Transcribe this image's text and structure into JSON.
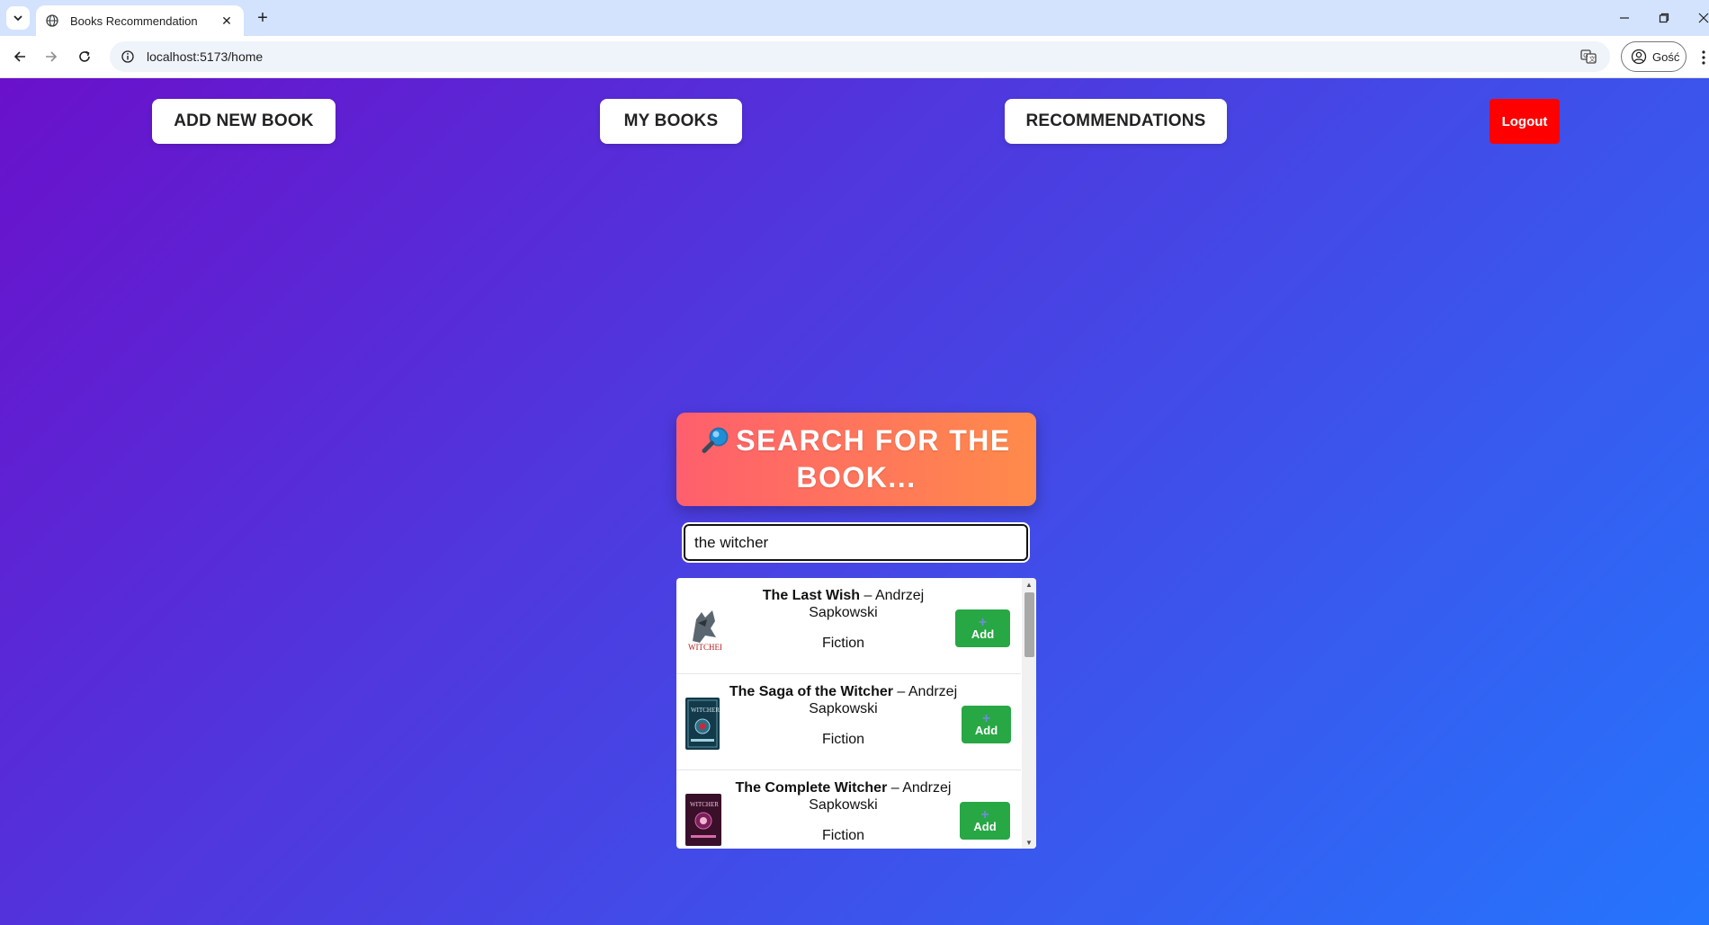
{
  "browser": {
    "tab_title": "Books Recommendation",
    "url": "localhost:5173/home",
    "profile_label": "Gość"
  },
  "nav": {
    "add_new_book": "ADD NEW BOOK",
    "my_books": "MY BOOKS",
    "recommendations": "RECOMMENDATIONS",
    "logout": "Logout"
  },
  "search": {
    "title": "SEARCH FOR THE BOOK...",
    "query": "the witcher"
  },
  "results": [
    {
      "title": "The Last Wish",
      "separator": " – ",
      "author": "Andrzej Sapkowski",
      "genre": "Fiction",
      "add_label": "Add",
      "add_icon": "+"
    },
    {
      "title": "The Saga of the Witcher",
      "separator": " – ",
      "author": "Andrzej Sapkowski",
      "genre": "Fiction",
      "add_label": "Add",
      "add_icon": "+"
    },
    {
      "title": "The Complete Witcher",
      "separator": " – ",
      "author": "Andrzej Sapkowski",
      "genre": "Fiction",
      "add_label": "Add",
      "add_icon": "+"
    }
  ],
  "icons": {
    "search": "magnifier-icon",
    "add": "plus-icon"
  },
  "colors": {
    "gradient_start": "#6a11cb",
    "gradient_end": "#2575fc",
    "search_card_start": "#ff5f6d",
    "search_card_end": "#ff8b4a",
    "logout": "#ff0000",
    "add_button": "#28a745"
  }
}
